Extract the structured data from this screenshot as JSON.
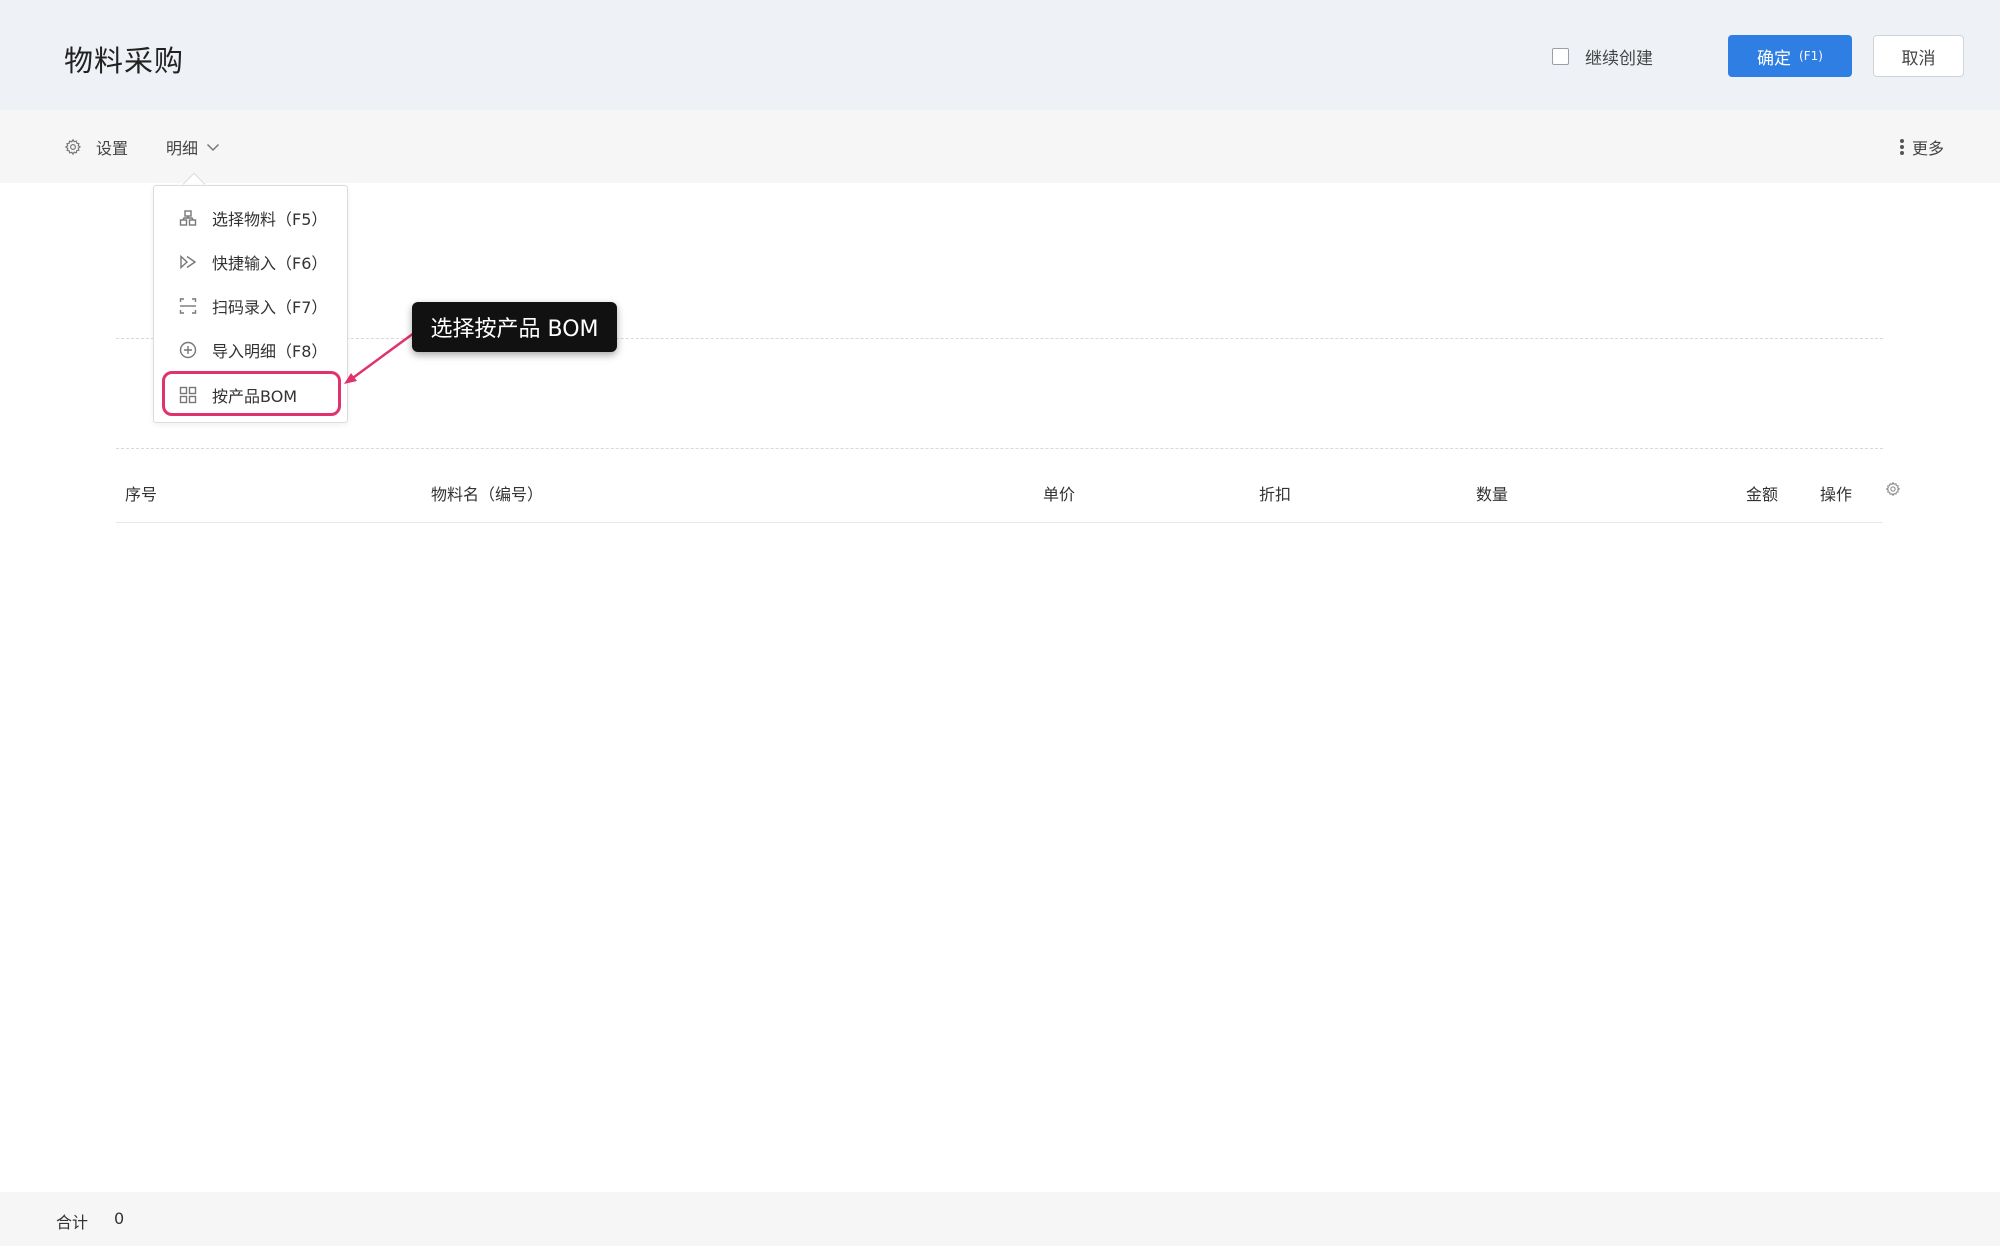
{
  "header": {
    "title": "物料采购",
    "continue_create_label": "继续创建",
    "continue_create_checked": false,
    "confirm_label": "确定",
    "confirm_key": "(F1)",
    "cancel_label": "取消",
    "confirm_color": "#2f7ee3"
  },
  "toolbar": {
    "settings_label": "设置",
    "settings_icon": "gear-icon",
    "detail_label": "明细",
    "detail_icon": "chevron-down-icon",
    "more_label": "更多",
    "more_icon": "vertical-dots-icon"
  },
  "detail_menu": {
    "items": [
      {
        "label": "选择物料（F5）",
        "icon": "hierarchy-icon"
      },
      {
        "label": "快捷输入（F6）",
        "icon": "play-outline-icon"
      },
      {
        "label": "扫码录入（F7）",
        "icon": "scan-icon"
      },
      {
        "label": "导入明细（F8）",
        "icon": "plus-circle-icon"
      },
      {
        "label": "按产品BOM",
        "icon": "grid-icon"
      }
    ],
    "highlighted_index": 4,
    "highlight_color": "#e0326e"
  },
  "annotation": {
    "text": "选择按产品 BOM"
  },
  "table": {
    "columns": [
      "序号",
      "物料名（编号）",
      "单价",
      "折扣",
      "数量",
      "金额",
      "操作"
    ],
    "settings_icon": "gear-icon",
    "rows": []
  },
  "footer": {
    "total_label": "合计",
    "total_value": "0"
  }
}
